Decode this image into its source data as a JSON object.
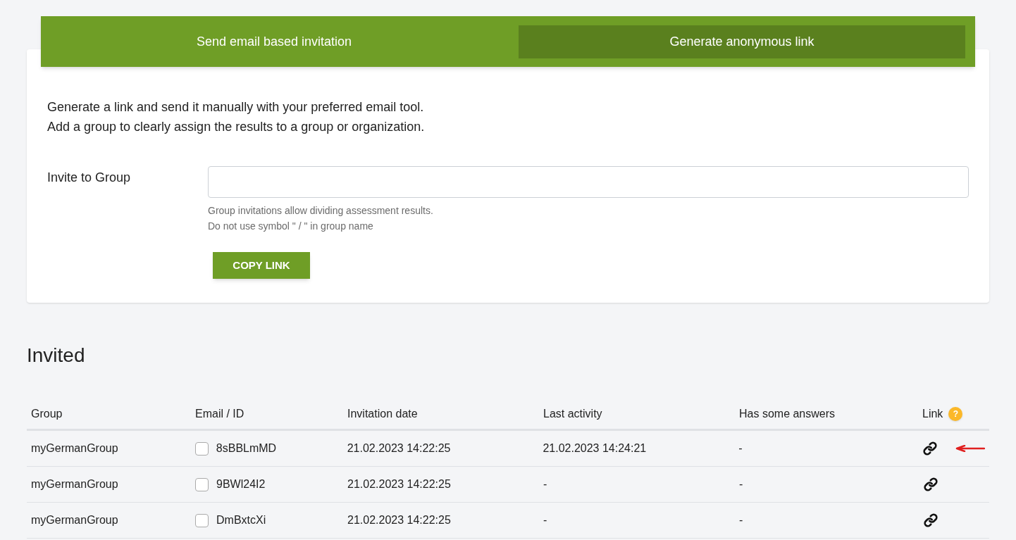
{
  "tabs": [
    {
      "label": "Send email based invitation",
      "selected": false
    },
    {
      "label": "Generate anonymous link",
      "selected": true
    }
  ],
  "intro": [
    "Generate a link and send it manually with your preferred email tool.",
    "Add a group to clearly assign the results to a group or organization."
  ],
  "group_field": {
    "label": "Invite to Group",
    "hints": [
      "Group invitations allow dividing assessment results.",
      "Do not use symbol \" / \" in group name"
    ]
  },
  "copy_button": "COPY LINK",
  "invited": {
    "title": "Invited",
    "columns": [
      "Group",
      "Email / ID",
      "Invitation date",
      "Last activity",
      "Has some answers",
      "Link"
    ],
    "help_badge": "?",
    "rows": [
      {
        "group": "myGermanGroup",
        "checked": false,
        "id": "8sBBLmMD",
        "invitation_date": "21.02.2023 14:22:25",
        "last_activity": "21.02.2023 14:24:21",
        "has_answers": "-",
        "annotated": true
      },
      {
        "group": "myGermanGroup",
        "checked": false,
        "id": "9BWl24I2",
        "invitation_date": "21.02.2023 14:22:25",
        "last_activity": "-",
        "has_answers": "-",
        "annotated": false
      },
      {
        "group": "myGermanGroup",
        "checked": false,
        "id": "DmBxtcXi",
        "invitation_date": "21.02.2023 14:22:25",
        "last_activity": "-",
        "has_answers": "-",
        "annotated": false
      }
    ]
  }
}
